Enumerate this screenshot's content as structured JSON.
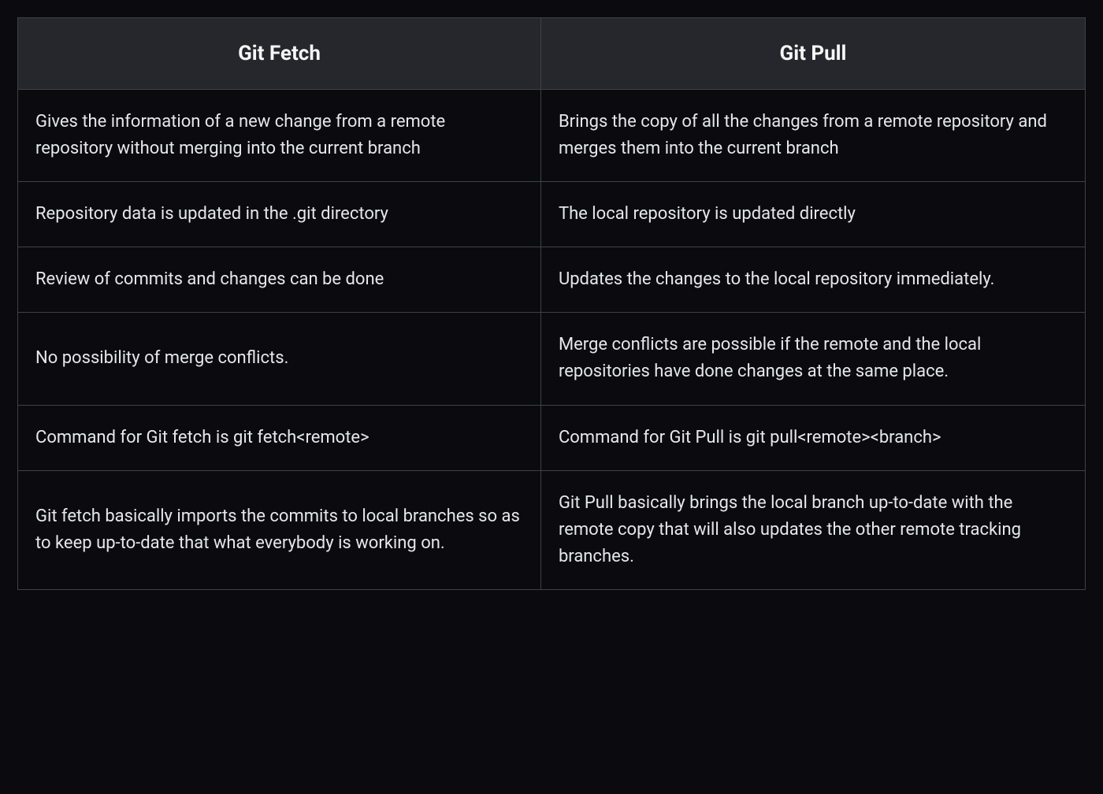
{
  "table": {
    "headers": {
      "left": "Git Fetch",
      "right": "Git Pull"
    },
    "rows": [
      {
        "left": "Gives the information of a new change from a remote repository without merging into the current branch",
        "right": "Brings the copy of all the changes from a remote repository and merges them into the current branch"
      },
      {
        "left": "Repository data is updated in the .git directory",
        "right": "The local repository is updated directly"
      },
      {
        "left": "Review of commits and changes can be done",
        "right": "Updates the changes to the local repository immediately."
      },
      {
        "left": "No possibility of merge conflicts.",
        "right": "Merge conflicts are possible if the remote and the local repositories have done changes at the same place."
      },
      {
        "left": "Command for Git fetch is git fetch<remote>",
        "right": "Command for Git Pull is git pull<remote><branch>"
      },
      {
        "left": "Git fetch basically imports the commits to local branches so as to keep up-to-date that what everybody is working on.",
        "right": "Git Pull basically brings the local branch up-to-date with the remote copy that will also updates the other remote tracking branches."
      }
    ]
  }
}
